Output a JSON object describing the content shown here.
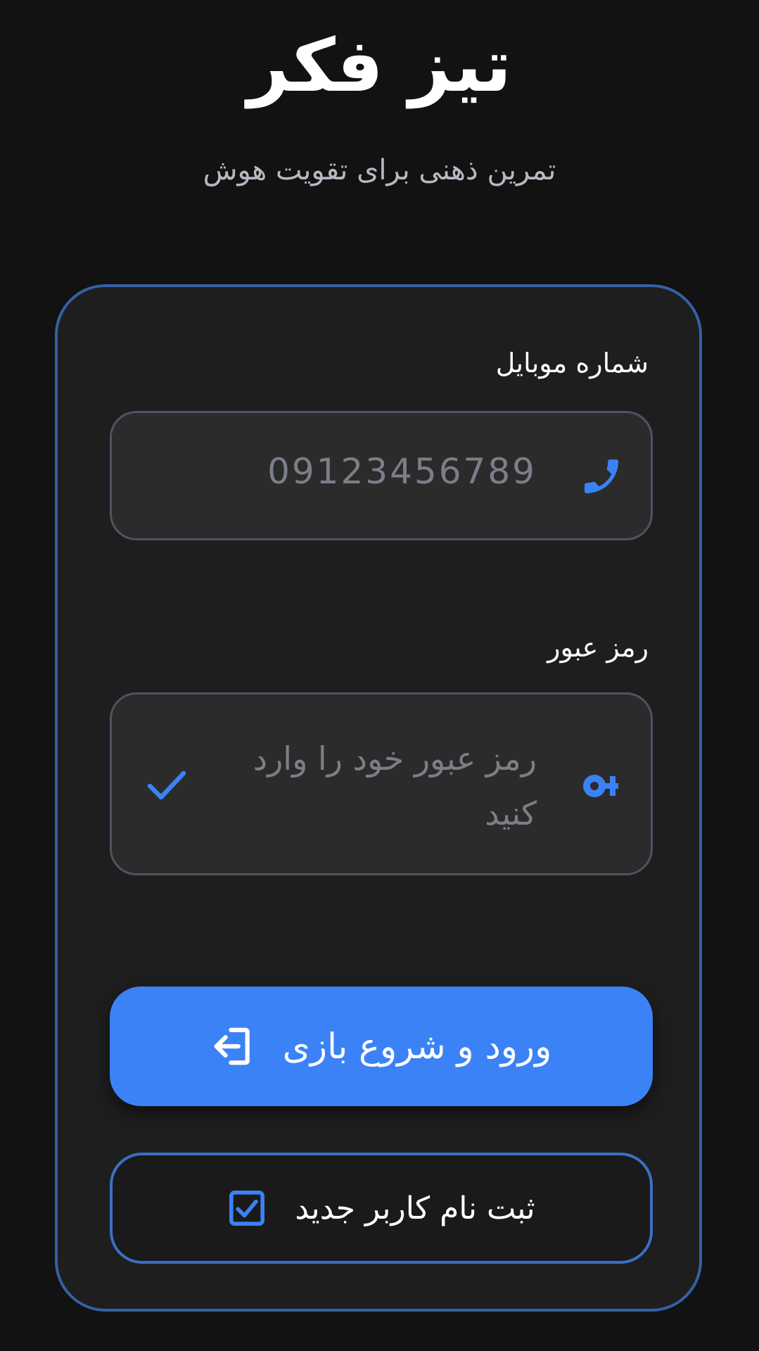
{
  "app": {
    "title": "تیز فکر",
    "subtitle": "تمرین ذهنی برای تقویت هوش"
  },
  "form": {
    "phone": {
      "label": "شماره موبایل",
      "value": "09123456789",
      "icon": "phone-icon"
    },
    "password": {
      "label": "رمز عبور",
      "placeholder": "رمز عبور خود را وارد کنید",
      "icon": "key-icon",
      "trailing_icon": "check-icon"
    },
    "login_button": {
      "label": "ورود و شروع بازی",
      "icon": "login-icon"
    },
    "register_button": {
      "label": "ثبت نام کاربر جدید",
      "icon": "checkbox-icon"
    }
  },
  "colors": {
    "background": "#121212",
    "card": "#1e1e1e",
    "card_border": "#3461a3",
    "accent": "#3b82f6",
    "input_bg": "#2b2b2b",
    "input_border": "#4b5563",
    "placeholder": "#7a7f88",
    "subtitle": "#b5b9c2"
  }
}
